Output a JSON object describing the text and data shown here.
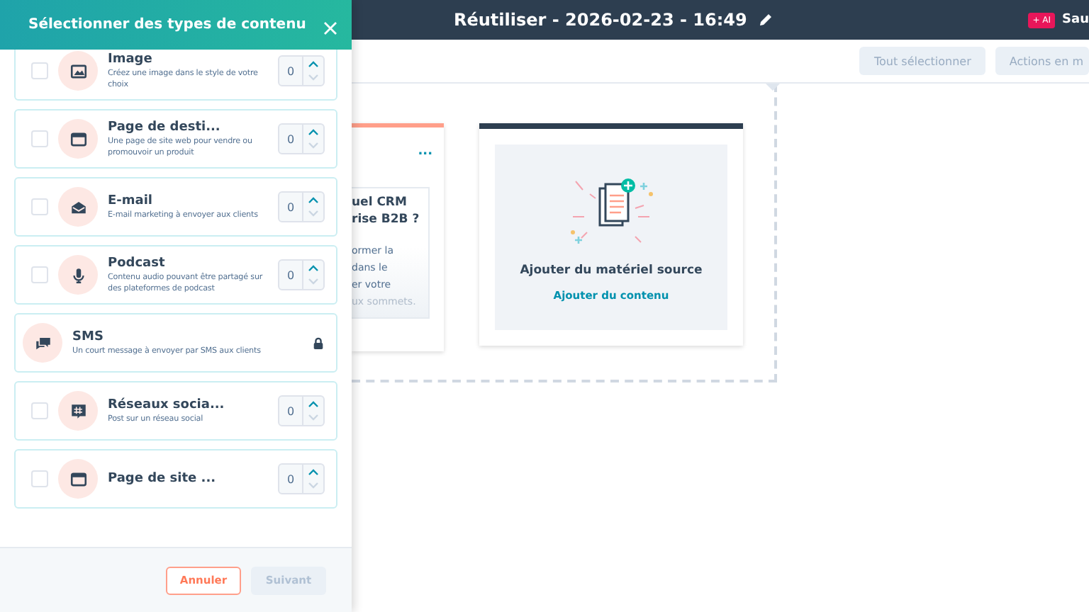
{
  "top_bar": {
    "title": "Réutiliser - 2026-02-23 - 16:49",
    "ai_badge": "+ AI",
    "save_label": "Sau"
  },
  "toolbar": {
    "buttons": [
      "Tout sélectionner",
      "Actions en m"
    ]
  },
  "canvas": {
    "content_card": {
      "title_lines": [
        "uel CRM",
        "rise B2B ?"
      ],
      "body_lines": [
        "ormer la",
        "dans le",
        "er votre",
        "ux sommets."
      ],
      "menu": "..."
    },
    "source_card": {
      "title": "Ajouter du matériel source",
      "link": "Ajouter du contenu"
    }
  },
  "panel": {
    "title": "Sélectionner des types de contenu",
    "items": [
      {
        "kind": "selectable",
        "title": "Image",
        "description": "Créez une image dans le style de votre choix",
        "checked": false,
        "count": "0"
      },
      {
        "kind": "selectable",
        "title": "Page de desti...",
        "description": "Une page de site web pour vendre ou promouvoir un produit",
        "checked": false,
        "count": "0"
      },
      {
        "kind": "selectable",
        "title": "E-mail",
        "description": "E-mail marketing à envoyer aux clients",
        "checked": false,
        "count": "0"
      },
      {
        "kind": "selectable",
        "title": "Podcast",
        "description": "Contenu audio pouvant être partagé sur des plateformes de podcast",
        "checked": false,
        "count": "0"
      },
      {
        "kind": "locked",
        "title": "SMS",
        "description": "Un court message à envoyer par SMS aux clients"
      },
      {
        "kind": "selectable",
        "title": "Réseaux socia...",
        "description": "Post sur un réseau social",
        "checked": false,
        "count": "0"
      },
      {
        "kind": "selectable",
        "title": "Page de site ...",
        "checked": false,
        "count": "0"
      }
    ],
    "footer": {
      "cancel": "Annuler",
      "next": "Suivant",
      "next_disabled": true
    }
  }
}
